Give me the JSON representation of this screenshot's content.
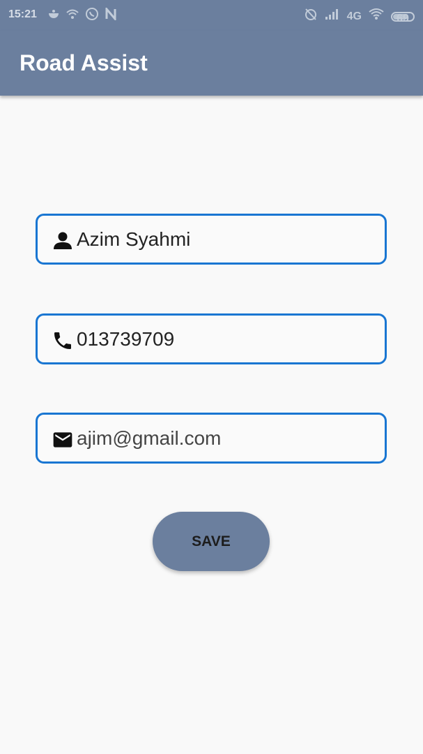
{
  "status_bar": {
    "time": "15:21",
    "left_icons": [
      "bowl-icon",
      "wifi-outline-icon",
      "whatsapp-icon",
      "n-icon"
    ],
    "network": "4G",
    "battery_level": "69"
  },
  "app_bar": {
    "title": "Road Assist"
  },
  "form": {
    "name": {
      "value": "Azim Syahmi",
      "icon": "person-icon"
    },
    "phone": {
      "value": "013739709",
      "icon": "phone-icon"
    },
    "email": {
      "value": "ajim@gmail.com",
      "icon": "mail-icon"
    },
    "save_label": "SAVE"
  },
  "colors": {
    "primary": "#6b7f9e",
    "field_border": "#1976d2",
    "background": "#f9f9f9"
  }
}
